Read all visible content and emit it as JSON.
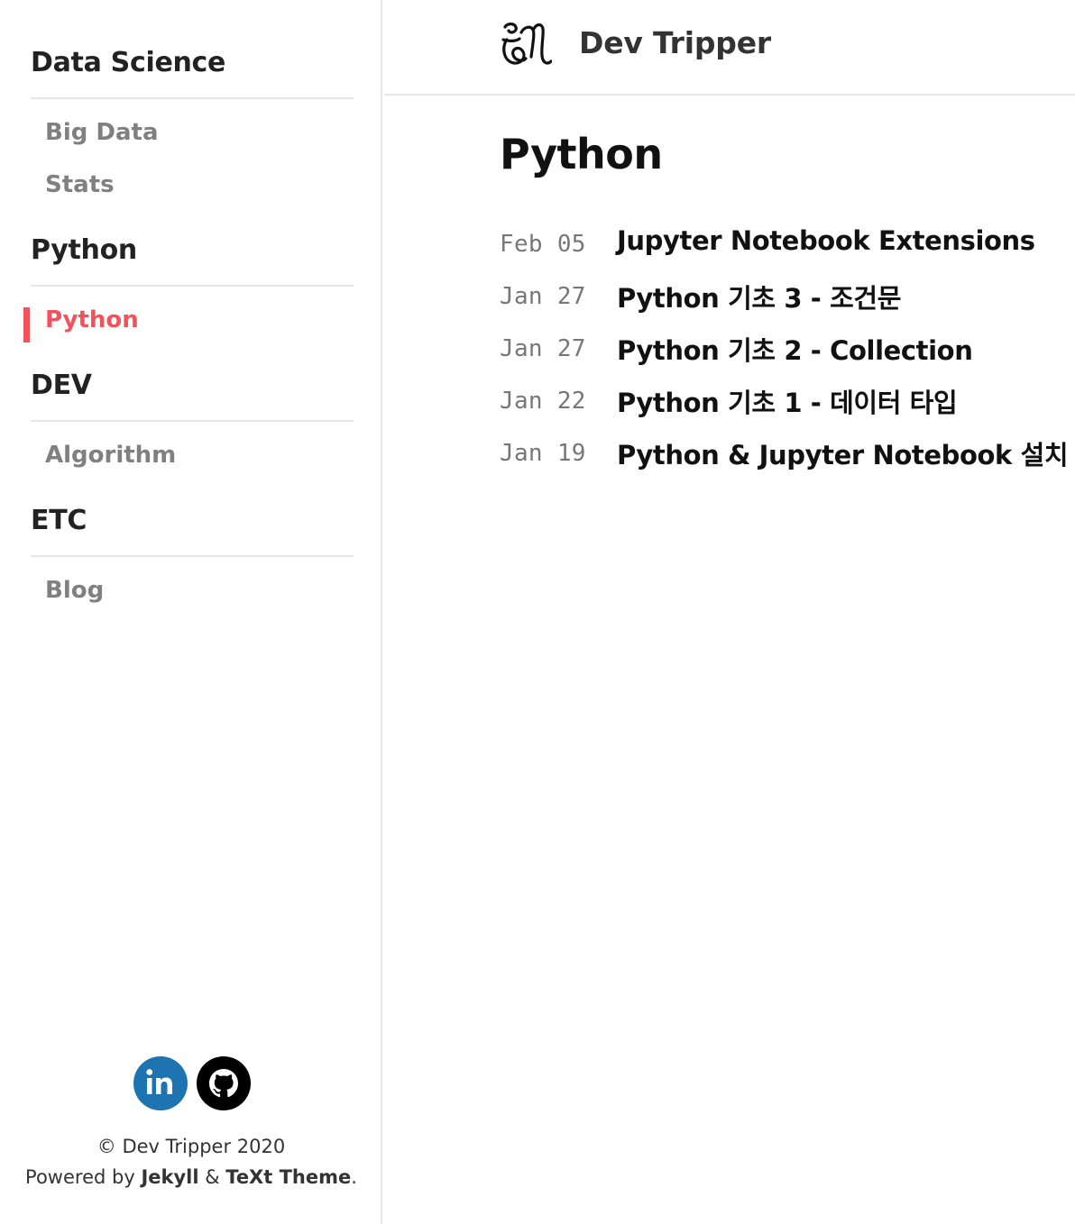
{
  "sidebar": {
    "sections": [
      {
        "title": "Data Science",
        "items": [
          "Big Data",
          "Stats"
        ]
      },
      {
        "title": "Python",
        "items": [
          "Python"
        ]
      },
      {
        "title": "DEV",
        "items": [
          "Algorithm"
        ]
      },
      {
        "title": "ETC",
        "items": [
          "Blog"
        ]
      }
    ],
    "active_item": "Python",
    "accent_color": "#f4515a",
    "social": [
      {
        "name": "linkedin-icon",
        "label": "in",
        "color": "#1d74b0"
      },
      {
        "name": "github-icon",
        "color": "#000000"
      }
    ],
    "footer": {
      "copyright": "© Dev Tripper 2020",
      "powered_prefix": "Powered by ",
      "jekyll": "Jekyll",
      "and": " & ",
      "theme": "TeXt Theme",
      "suffix": "."
    }
  },
  "header": {
    "site_title": "Dev Tripper",
    "logo_icon": "monogram-logo-icon"
  },
  "main": {
    "page_title": "Python",
    "posts": [
      {
        "date": "Feb 05",
        "title": "Jupyter Notebook Extensions"
      },
      {
        "date": "Jan 27",
        "title": "Python 기초 3 - 조건문"
      },
      {
        "date": "Jan 27",
        "title": "Python 기초 2 - Collection"
      },
      {
        "date": "Jan 22",
        "title": "Python 기초 1 - 데이터 타입"
      },
      {
        "date": "Jan 19",
        "title": "Python & Jupyter Notebook 설치"
      }
    ]
  }
}
